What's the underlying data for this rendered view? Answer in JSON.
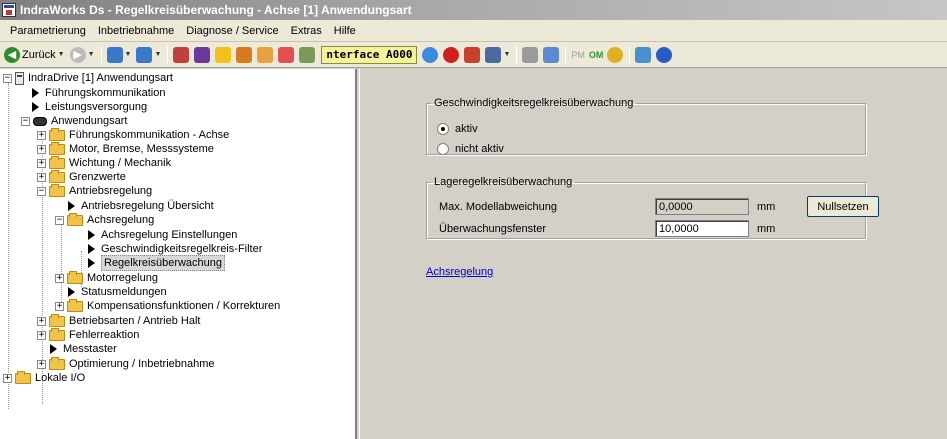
{
  "window": {
    "title": "IndraWorks Ds - Regelkreisüberwachung - Achse [1] Anwendungsart"
  },
  "menu": {
    "items": [
      "Parametrierung",
      "Inbetriebnahme",
      "Diagnose / Service",
      "Extras",
      "Hilfe"
    ]
  },
  "toolbar": {
    "back_label": "Zurück",
    "terminal_text": "nterface  A000",
    "pm_label": "PM",
    "om_label": "OM"
  },
  "tree": {
    "items": [
      {
        "label": "IndraDrive [1] Anwendungsart",
        "icon": "drive-icon",
        "expander": "minus"
      },
      {
        "label": "Führungskommunikation",
        "icon": "arrow-icon"
      },
      {
        "label": "Leistungsversorgung",
        "icon": "arrow-icon"
      },
      {
        "label": "Anwendungsart",
        "icon": "disk-icon",
        "expander": "minus"
      },
      {
        "label": "Führungskommunikation - Achse",
        "icon": "folder-icon",
        "expander": "plus"
      },
      {
        "label": "Motor, Bremse, Messsysteme",
        "icon": "folder-icon",
        "expander": "plus"
      },
      {
        "label": "Wichtung / Mechanik",
        "icon": "folder-icon",
        "expander": "plus"
      },
      {
        "label": "Grenzwerte",
        "icon": "folder-icon",
        "expander": "plus"
      },
      {
        "label": "Antriebsregelung",
        "icon": "folder-icon",
        "expander": "minus"
      },
      {
        "label": "Antriebsregelung Übersicht",
        "icon": "arrow-icon"
      },
      {
        "label": "Achsregelung",
        "icon": "folder-icon",
        "expander": "minus"
      },
      {
        "label": "Achsregelung Einstellungen",
        "icon": "arrow-icon"
      },
      {
        "label": "Geschwindigkeitsregelkreis-Filter",
        "icon": "arrow-icon"
      },
      {
        "label": "Regelkreisüberwachung",
        "icon": "arrow-icon",
        "selected": true
      },
      {
        "label": "Motorregelung",
        "icon": "folder-icon",
        "expander": "plus"
      },
      {
        "label": "Statusmeldungen",
        "icon": "arrow-icon"
      },
      {
        "label": "Kompensationsfunktionen / Korrekturen",
        "icon": "folder-icon",
        "expander": "plus"
      },
      {
        "label": "Betriebsarten / Antrieb Halt",
        "icon": "folder-icon",
        "expander": "plus"
      },
      {
        "label": "Fehlerreaktion",
        "icon": "folder-icon",
        "expander": "plus"
      },
      {
        "label": "Messtaster",
        "icon": "arrow-icon"
      },
      {
        "label": "Optimierung / Inbetriebnahme",
        "icon": "folder-icon",
        "expander": "plus"
      },
      {
        "label": "Lokale I/O",
        "icon": "folder-icon",
        "expander": "plus"
      }
    ]
  },
  "content": {
    "speed_group": {
      "legend": "Geschwindigkeitsregelkreisüberwachung",
      "options": [
        "aktiv",
        "nicht aktiv"
      ],
      "selected": "aktiv"
    },
    "position_group": {
      "legend": "Lageregelkreisüberwachung",
      "max_deviation_label": "Max. Modellabweichung",
      "max_deviation_value": "0,0000",
      "max_deviation_unit": "mm",
      "reset_button": "Nullsetzen",
      "window_label": "Überwachungsfenster",
      "window_value": "10,0000",
      "window_unit": "mm"
    },
    "link_label": "Achsregelung"
  }
}
